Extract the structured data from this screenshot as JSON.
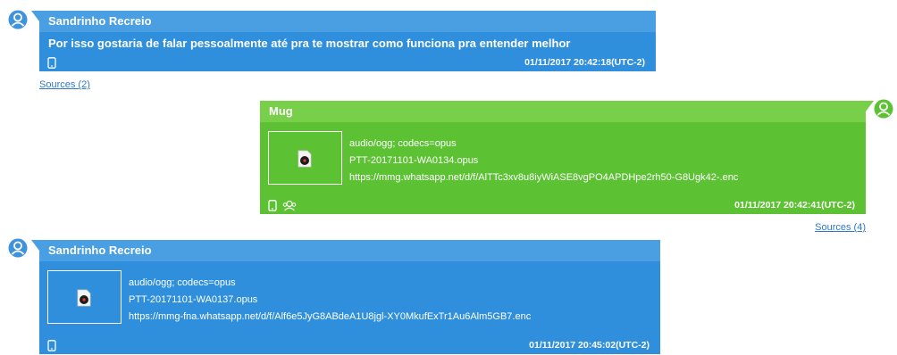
{
  "messages": [
    {
      "sender": "Sandrinho Recreio",
      "text": "Por isso gostaria de falar pessoalmente até pra te mostrar como funciona pra entender melhor",
      "timestamp": "01/11/2017 20:42:18(UTC-2)",
      "sources": "Sources (2)"
    },
    {
      "sender": "Mug",
      "mime": "audio/ogg; codecs=opus",
      "filename": "PTT-20171101-WA0134.opus",
      "url": "https://mmg.whatsapp.net/d/f/AlTTc3xv8u8iyWiASE8vgPO4APDHpe2rh50-G8Ugk42-.enc",
      "timestamp": "01/11/2017 20:42:41(UTC-2)",
      "sources": "Sources (4)"
    },
    {
      "sender": "Sandrinho Recreio",
      "mime": "audio/ogg; codecs=opus",
      "filename": "PTT-20171101-WA0137.opus",
      "url": "https://mmg-fna.whatsapp.net/d/f/Alf6e5JyG8ABdeA1U8jgl-XY0MkufExTr1Au6Alm5GB7.enc",
      "timestamp": "01/11/2017 20:45:02(UTC-2)"
    }
  ],
  "colors": {
    "incoming": "#2f8fdc",
    "outgoing": "#5cc133",
    "link": "#2f78c4"
  },
  "icons": [
    "user-avatar-icon",
    "phone-icon",
    "group-icon",
    "audio-file-icon"
  ]
}
